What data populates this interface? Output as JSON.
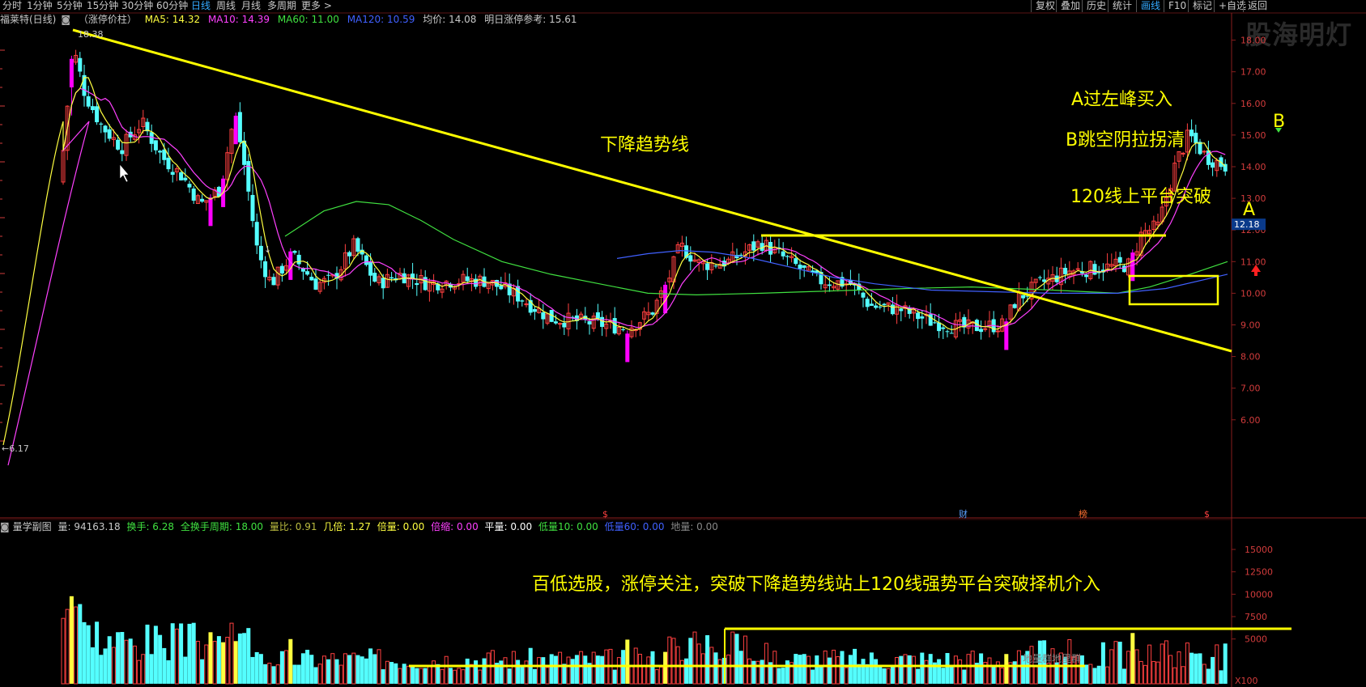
{
  "toolbar": {
    "left": [
      "分时",
      "1分钟",
      "5分钟",
      "15分钟",
      "30分钟",
      "60分钟",
      "日线",
      "周线",
      "月线",
      "多周期",
      "更多 >"
    ],
    "active_left": "日线",
    "right": [
      "复权",
      "叠加",
      "历史",
      "统计",
      "画线",
      "F10",
      "标记",
      "+自选",
      "返回"
    ],
    "active_right": "画线"
  },
  "header": {
    "stock": "福莱特(日线)",
    "indicator": "（涨停价柱）",
    "ma5": "MA5: 14.32",
    "ma10": "MA10: 14.39",
    "ma60": "MA60: 11.00",
    "ma120": "MA120: 10.59",
    "avg": "均价: 14.08",
    "next_limit": "明日涨停参考: 15.61"
  },
  "watermark": "股海明灯",
  "colors": {
    "up": "#ff4040",
    "down": "#54ffff",
    "limit": "#ff00ff",
    "ma5": "#ffff40",
    "ma10": "#ff40ff",
    "ma60": "#40e040",
    "ma120": "#4060ff",
    "annotation": "#ffff00",
    "axis": "#d23c3c"
  },
  "chart_data": {
    "type": "candlestick",
    "price_axis": [
      "18.00",
      "17.00",
      "16.00",
      "15.00",
      "14.00",
      "13.00",
      "12.00",
      "11.00",
      "10.00",
      "9.00",
      "8.00",
      "7.00",
      "6.00"
    ],
    "ylim": [
      5,
      18.6
    ],
    "high_label": "18.38",
    "low_label": "6.17",
    "current_price": "12.18",
    "annotations": {
      "downtrend": "下降趋势线",
      "buy_a": "A过左峰买入",
      "buy_b": "B跳空阴拉拐清",
      "platform": "120线上平台突破",
      "label_a": "A",
      "label_b": "B",
      "event_marks": [
        "$",
        "财",
        "榜",
        "$"
      ],
      "ridge": "地量群地里群",
      "summary": "百低选股，涨停关注，突破下降趋势线站上120线强势平台突破择机介入"
    },
    "volume_axis": [
      "15000",
      "12500",
      "10000",
      "7500",
      "5000"
    ],
    "volume_unit": "X100",
    "volume_info": {
      "title": "量学副图",
      "vol": "量: 94163.18",
      "turnover": "换手: 6.28",
      "period": "全换手周期: 18.00",
      "ratio": "量比: 0.91",
      "times": "几倍: 1.27",
      "double": "倍量: 0.00",
      "shrink": "倍缩: 0.00",
      "flat": "平量: 0.00",
      "low10": "低量10: 0.00",
      "low60": "低量60: 0.00",
      "ground": "地量: 0.00"
    }
  }
}
